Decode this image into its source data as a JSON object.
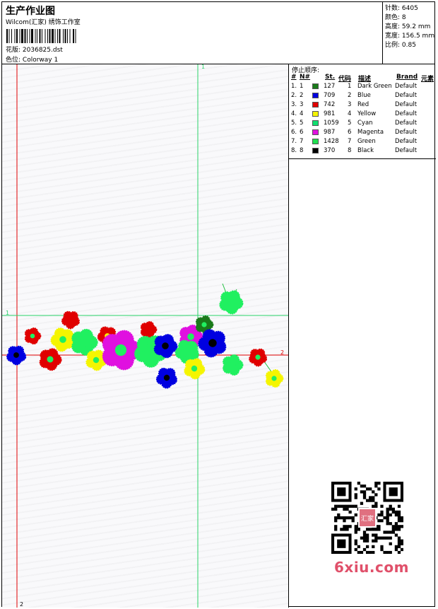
{
  "header": {
    "title": "生产作业图",
    "software": "Wilcom(汇家) 绣饰工作室",
    "design_label": "花版:",
    "design_name": "2036825.dst",
    "colorway_label": "色位:",
    "colorway_name": "Colorway 1"
  },
  "stats": [
    {
      "label": "针数:",
      "value": "6405"
    },
    {
      "label": "颜色:",
      "value": "8"
    },
    {
      "label": "高度:",
      "value": "59.2 mm"
    },
    {
      "label": "宽度:",
      "value": "156.5 mm"
    },
    {
      "label": "比例:",
      "value": "0.85"
    }
  ],
  "stop_sequence": {
    "title": "停止顺序:",
    "columns": {
      "hash": "#",
      "no": "N#",
      "stitches": "St.",
      "code": "代码",
      "desc": "描述",
      "brand": "Brand",
      "element": "元素"
    },
    "rows": [
      {
        "hash": "1.",
        "no": "1",
        "color": "#1a7a1a",
        "stitches": "127",
        "code": "1",
        "desc": "Dark Green",
        "brand": "Default"
      },
      {
        "hash": "2.",
        "no": "2",
        "color": "#0000e0",
        "stitches": "709",
        "code": "2",
        "desc": "Blue",
        "brand": "Default"
      },
      {
        "hash": "3.",
        "no": "3",
        "color": "#e00000",
        "stitches": "742",
        "code": "3",
        "desc": "Red",
        "brand": "Default"
      },
      {
        "hash": "4.",
        "no": "4",
        "color": "#f5f500",
        "stitches": "981",
        "code": "4",
        "desc": "Yellow",
        "brand": "Default"
      },
      {
        "hash": "5.",
        "no": "5",
        "color": "#10e070",
        "stitches": "1059",
        "code": "5",
        "desc": "Cyan",
        "brand": "Default"
      },
      {
        "hash": "6.",
        "no": "6",
        "color": "#e010e0",
        "stitches": "987",
        "code": "6",
        "desc": "Magenta",
        "brand": "Default"
      },
      {
        "hash": "7.",
        "no": "7",
        "color": "#20e050",
        "stitches": "1428",
        "code": "7",
        "desc": "Green",
        "brand": "Default"
      },
      {
        "hash": "8.",
        "no": "8",
        "color": "#000000",
        "stitches": "370",
        "code": "8",
        "desc": "Black",
        "brand": "Default"
      }
    ]
  },
  "guides": {
    "v1": "1",
    "h1": "1",
    "h2": "2",
    "v2": "2"
  },
  "watermark": "6xiu.com",
  "seal_text": "汇家"
}
